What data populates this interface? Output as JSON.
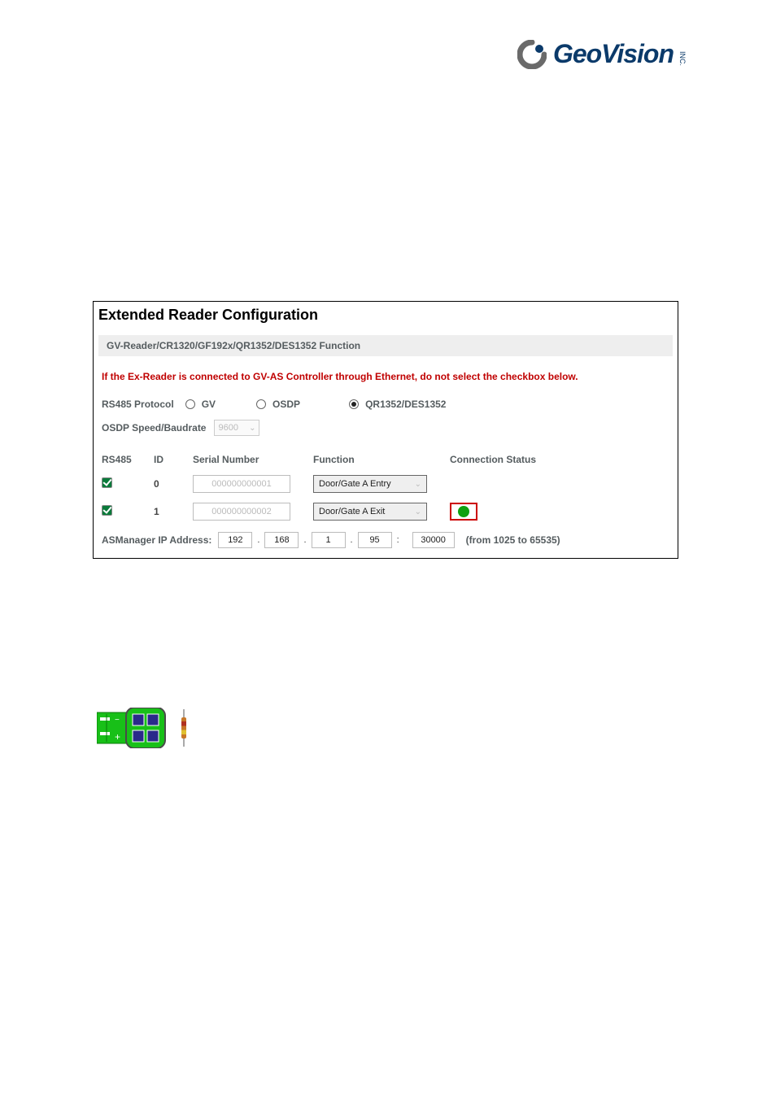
{
  "logo": {
    "brand": "GeoVision",
    "suffix": "INC."
  },
  "config": {
    "title": "Extended Reader Configuration",
    "section_header": "GV-Reader/CR1320/GF192x/QR1352/DES1352 Function",
    "warning": "If the Ex-Reader is connected to GV-AS Controller through Ethernet, do not select the checkbox below.",
    "protocol": {
      "label": "RS485 Protocol",
      "options": [
        {
          "name": "GV",
          "selected": false
        },
        {
          "name": "OSDP",
          "selected": false
        },
        {
          "name": "QR1352/DES1352",
          "selected": true
        }
      ]
    },
    "baudrate": {
      "label": "OSDP Speed/Baudrate",
      "value": "9600"
    },
    "table": {
      "headers": {
        "rs485": "RS485",
        "id": "ID",
        "serial": "Serial Number",
        "function": "Function",
        "status": "Connection Status"
      },
      "rows": [
        {
          "checked": true,
          "id": "0",
          "serial_placeholder": "000000000001",
          "function": "Door/Gate A Entry",
          "status": null
        },
        {
          "checked": true,
          "id": "1",
          "serial_placeholder": "000000000002",
          "function": "Door/Gate A Exit",
          "status": "connected"
        }
      ]
    },
    "ip": {
      "label": "ASManager IP Address:",
      "octets": [
        "192",
        "168",
        "1",
        "95"
      ],
      "port": "30000",
      "range": "(from 1025 to 65535)"
    }
  }
}
